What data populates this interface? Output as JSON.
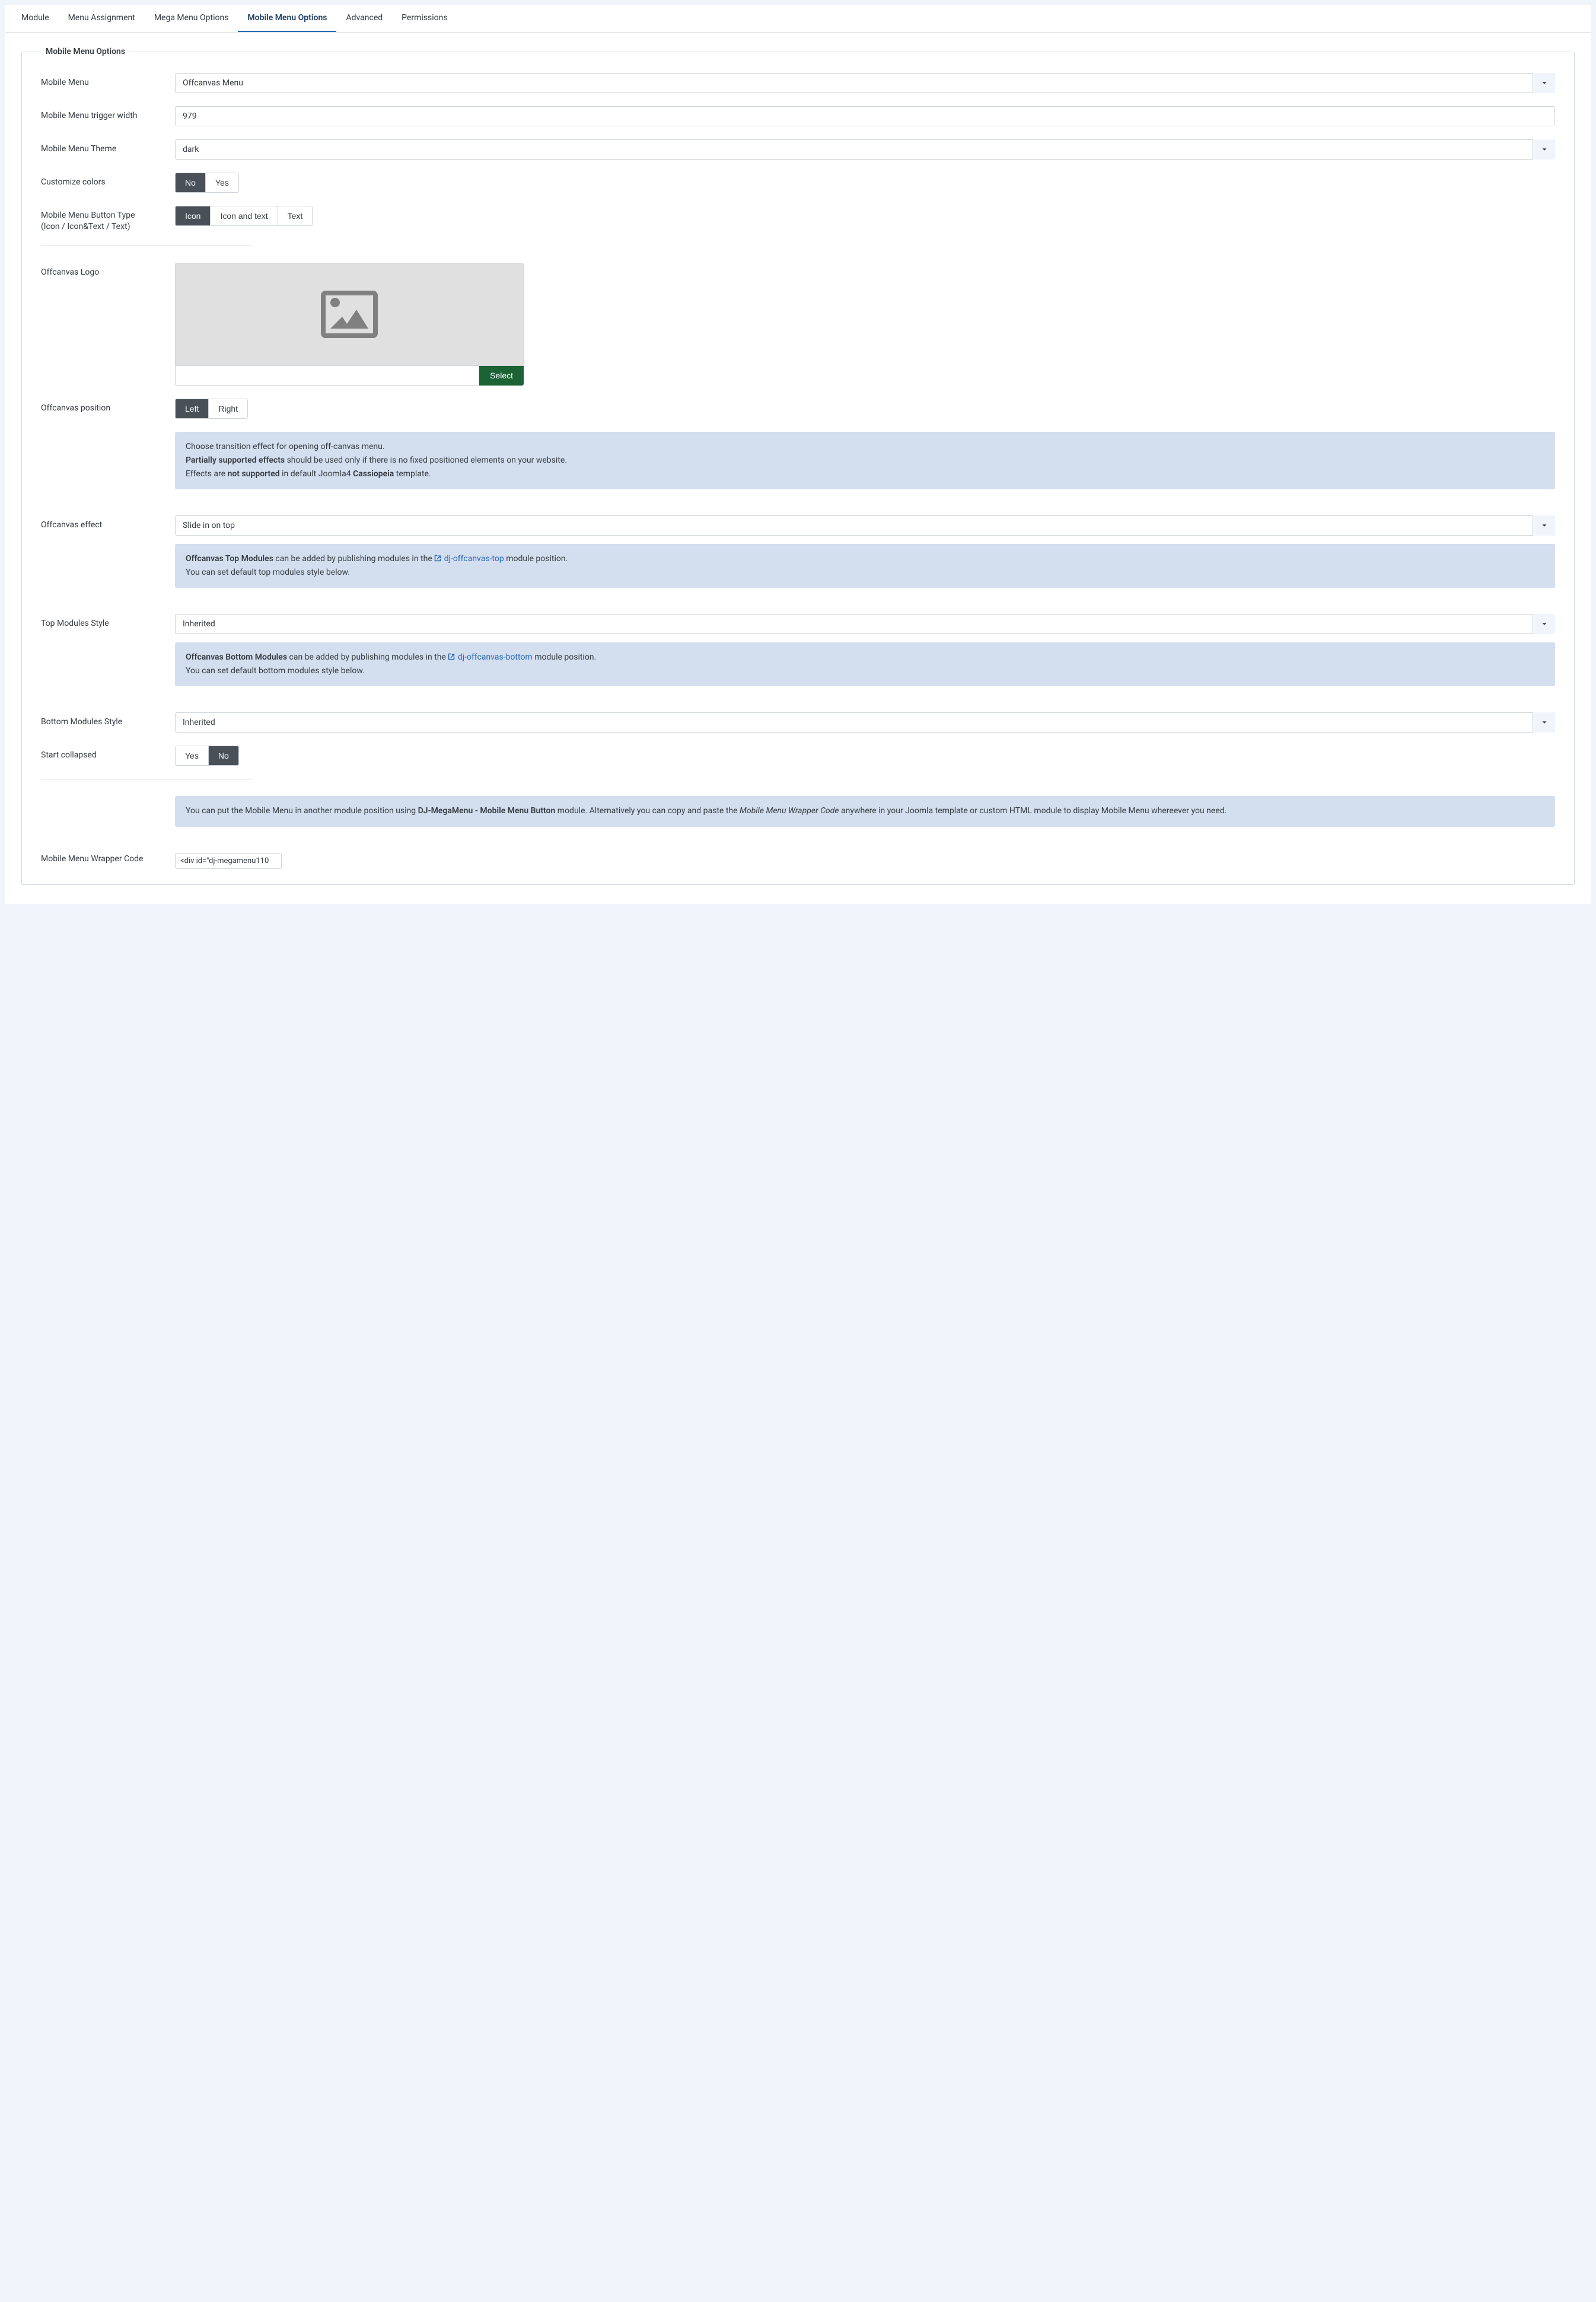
{
  "tabs": {
    "module": "Module",
    "menu_assignment": "Menu Assignment",
    "mega_menu_options": "Mega Menu Options",
    "mobile_menu_options": "Mobile Menu Options",
    "advanced": "Advanced",
    "permissions": "Permissions"
  },
  "fieldset_legend": "Mobile Menu Options",
  "labels": {
    "mobile_menu": "Mobile Menu",
    "trigger_width": "Mobile Menu trigger width",
    "theme": "Mobile Menu Theme",
    "customize_colors": "Customize colors",
    "button_type_l1": "Mobile Menu Button Type",
    "button_type_l2": "(Icon / Icon&Text / Text)",
    "offcanvas_logo": "Offcanvas Logo",
    "offcanvas_position": "Offcanvas position",
    "offcanvas_effect": "Offcanvas effect",
    "top_modules_style": "Top Modules Style",
    "bottom_modules_style": "Bottom Modules Style",
    "start_collapsed": "Start collapsed",
    "wrapper_code": "Mobile Menu Wrapper Code"
  },
  "values": {
    "mobile_menu": "Offcanvas Menu",
    "trigger_width": "979",
    "theme": "dark",
    "offcanvas_effect": "Slide in on top",
    "top_modules_style": "Inherited",
    "bottom_modules_style": "Inherited",
    "wrapper_code": "<div id=\"dj-megamenu110"
  },
  "buttons": {
    "no": "No",
    "yes": "Yes",
    "icon": "Icon",
    "icon_and_text": "Icon and text",
    "text": "Text",
    "left": "Left",
    "right": "Right",
    "select": "Select"
  },
  "alerts": {
    "transition": {
      "l1": "Choose transition effect for opening off-canvas menu.",
      "l2a": "Partially supported effects",
      "l2b": " should be used only if there is no fixed positioned elements on your website.",
      "l3a": "Effects are ",
      "l3b": "not supported",
      "l3c": " in default Joomla4 ",
      "l3d": "Cassiopeia",
      "l3e": " template."
    },
    "top_modules": {
      "l1a": "Offcanvas Top Modules",
      "l1b": " can be added by publishing modules in the ",
      "link": "dj-offcanvas-top",
      "l1c": " module position.",
      "l2": "You can set default top modules style below."
    },
    "bottom_modules": {
      "l1a": "Offcanvas Bottom Modules",
      "l1b": " can be added by publishing modules in the ",
      "link": "dj-offcanvas-bottom",
      "l1c": " module position.",
      "l2": "You can set default bottom modules style below."
    },
    "wrapper": {
      "l1a": "You can put the Mobile Menu in another module position using ",
      "l1b": "DJ-MegaMenu - Mobile Menu Button",
      "l1c": " module. Alternatively you can copy and paste the ",
      "l1d": "Mobile Menu Wrapper Code",
      "l1e": " anywhere in your Joomla template or custom HTML module to display Mobile Menu whereever you need."
    }
  }
}
